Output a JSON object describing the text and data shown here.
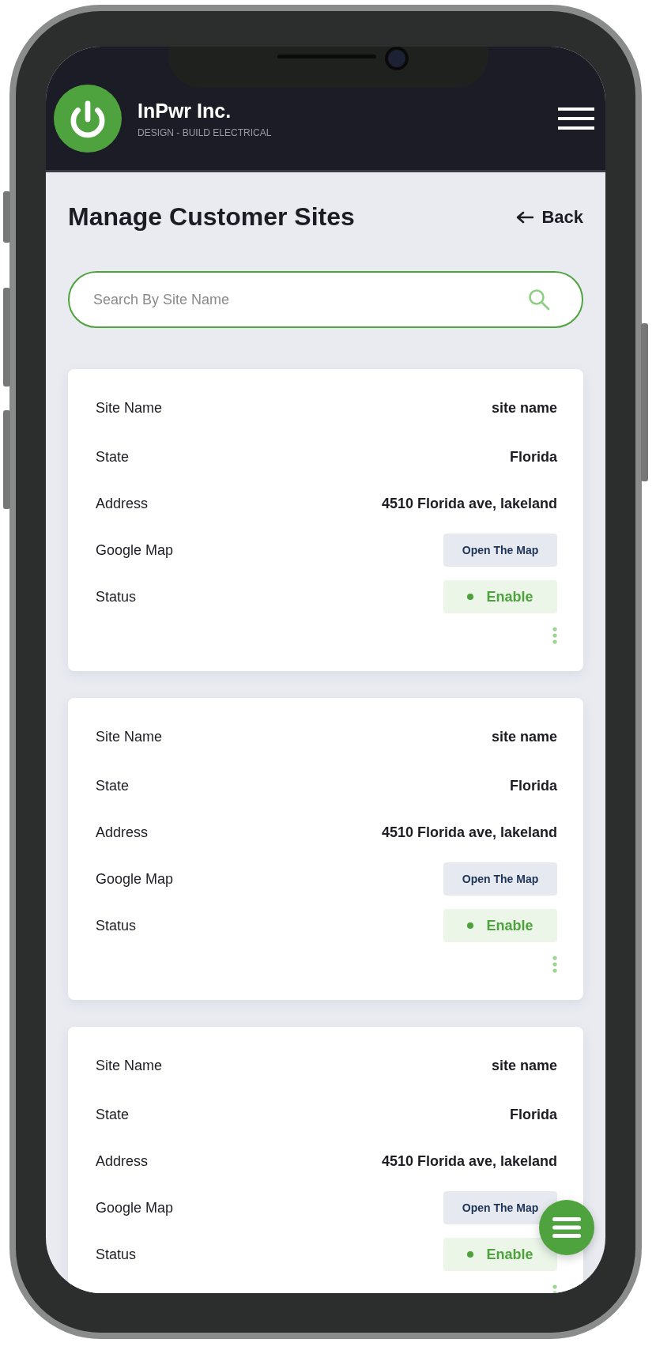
{
  "header": {
    "company": "InPwr Inc.",
    "tagline": "DESIGN - BUILD ELECTRICAL"
  },
  "page": {
    "title": "Manage Customer Sites",
    "back": "Back"
  },
  "search": {
    "placeholder": "Search By Site Name"
  },
  "sites": [
    {
      "fields": [
        {
          "label": "Site Name",
          "value": "site name"
        },
        {
          "label": "State",
          "value": "Florida"
        },
        {
          "label": "Address",
          "value": "4510 Florida ave, lakeland"
        }
      ],
      "map_label": "Google Map",
      "map_button": "Open The Map",
      "status_label": "Status",
      "status": "Enable",
      "enabled": true
    },
    {
      "fields": [
        {
          "label": "Site Name",
          "value": "site name"
        },
        {
          "label": "State",
          "value": "Florida"
        },
        {
          "label": "Address",
          "value": "4510 Florida ave, lakeland"
        }
      ],
      "map_label": "Google Map",
      "map_button": "Open The Map",
      "status_label": "Status",
      "status": "Enable",
      "enabled": true
    },
    {
      "fields": [
        {
          "label": "Site Name",
          "value": "site name"
        },
        {
          "label": "State",
          "value": "Florida"
        },
        {
          "label": "Address",
          "value": "4510 Florida ave, lakeland"
        }
      ],
      "map_label": "Google Map",
      "map_button": "Open The Map",
      "status_label": "Status",
      "status": "Enable",
      "enabled": true
    }
  ]
}
